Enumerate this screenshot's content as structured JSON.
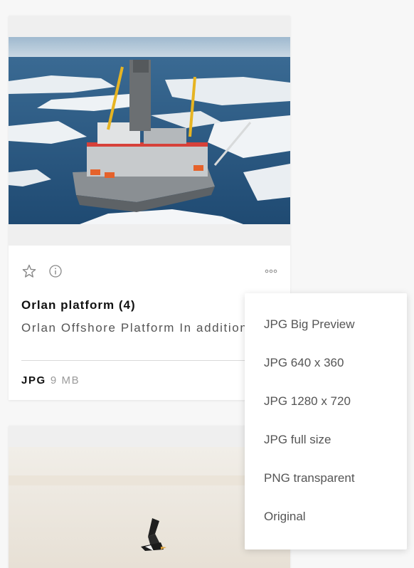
{
  "card": {
    "title": "Orlan platform (4)",
    "description": "Orlan Offshore Platform In addition to",
    "format": "JPG",
    "size": "9 MB",
    "icons": [
      "star-icon",
      "info-icon",
      "more-icon"
    ]
  },
  "menu": {
    "items": [
      {
        "label": "JPG Big Preview"
      },
      {
        "label": "JPG 640 x 360"
      },
      {
        "label": "JPG 1280 x 720"
      },
      {
        "label": "JPG full size"
      },
      {
        "label": "PNG transparent"
      },
      {
        "label": "Original"
      }
    ]
  },
  "colors": {
    "page_bg": "#f7f7f7",
    "card_bg": "#ffffff",
    "media_bg": "#efefef",
    "sea": "#2f5f8c",
    "ice": "#e9eef2"
  }
}
